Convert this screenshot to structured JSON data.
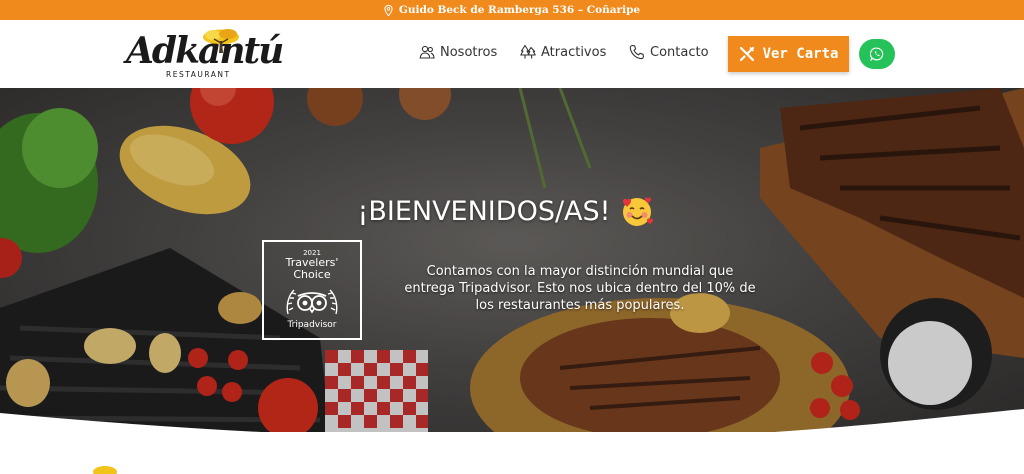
{
  "topbar": {
    "address": "Guido Beck de Ramberga 536 – Coñaripe",
    "icon": "map-pin-icon"
  },
  "brand": {
    "logo_text": "Adkantú",
    "logo_sub": "RESTAURANT"
  },
  "nav": {
    "items": [
      {
        "label": "Nosotros",
        "icon": "people-icon"
      },
      {
        "label": "Atractivos",
        "icon": "trees-icon"
      },
      {
        "label": "Contacto",
        "icon": "phone-icon"
      }
    ],
    "cta_label": "Ver Carta",
    "cta_icon": "utensils-icon",
    "whatsapp_icon": "whatsapp-icon"
  },
  "hero": {
    "title": "¡BIENVENIDOS/AS!",
    "badge": {
      "year": "2021",
      "line1": "Travelers'",
      "line2": "Choice",
      "brand": "Tripadvisor"
    },
    "text": "Contamos con la mayor distinción mundial que entrega Tripadvisor. Esto nos ubica dentro del 10% de los restaurantes más populares."
  },
  "colors": {
    "accent": "#f08a1c",
    "whatsapp": "#25c25a",
    "topbar_text": "#ffffff"
  }
}
